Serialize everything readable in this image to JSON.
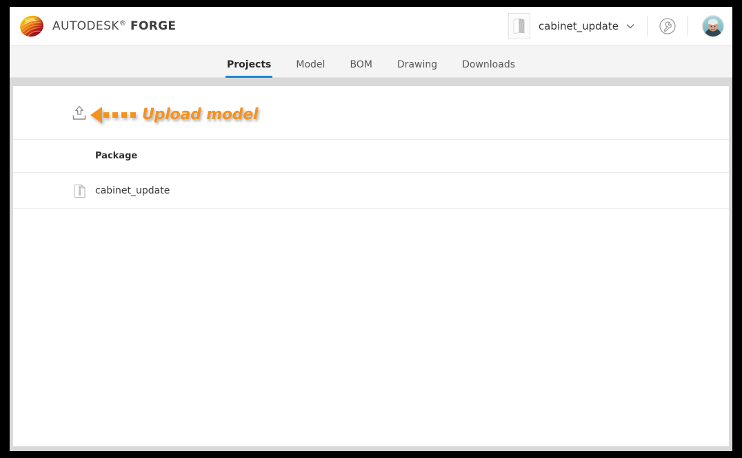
{
  "app": {
    "brand_prefix": "AUTODESK",
    "brand_reg": "®",
    "brand_product": "FORGE",
    "logo_icon": "autodesk-swirl-logo"
  },
  "header": {
    "model_thumbnail_icon": "cabinet-model-thumbnail",
    "document_name": "cabinet_update",
    "dropdown_icon": "chevron-down-icon",
    "tools_icon": "wrench-circle-icon",
    "avatar_icon": "user-avatar-photo"
  },
  "nav": {
    "tabs": [
      {
        "label": "Projects",
        "active": true
      },
      {
        "label": "Model",
        "active": false
      },
      {
        "label": "BOM",
        "active": false
      },
      {
        "label": "Drawing",
        "active": false
      },
      {
        "label": "Downloads",
        "active": false
      }
    ],
    "active_underline_color": "#1a8ad4"
  },
  "toolbar": {
    "upload_icon": "upload-icon",
    "annotation": {
      "text": "Upload model",
      "color": "#f5921e",
      "arrow_icon": "left-arrow-annotation",
      "dot_count": 4
    }
  },
  "table": {
    "columns": [
      "Package"
    ],
    "rows": [
      {
        "icon": "zip-archive-icon",
        "name": "cabinet_update"
      }
    ]
  }
}
